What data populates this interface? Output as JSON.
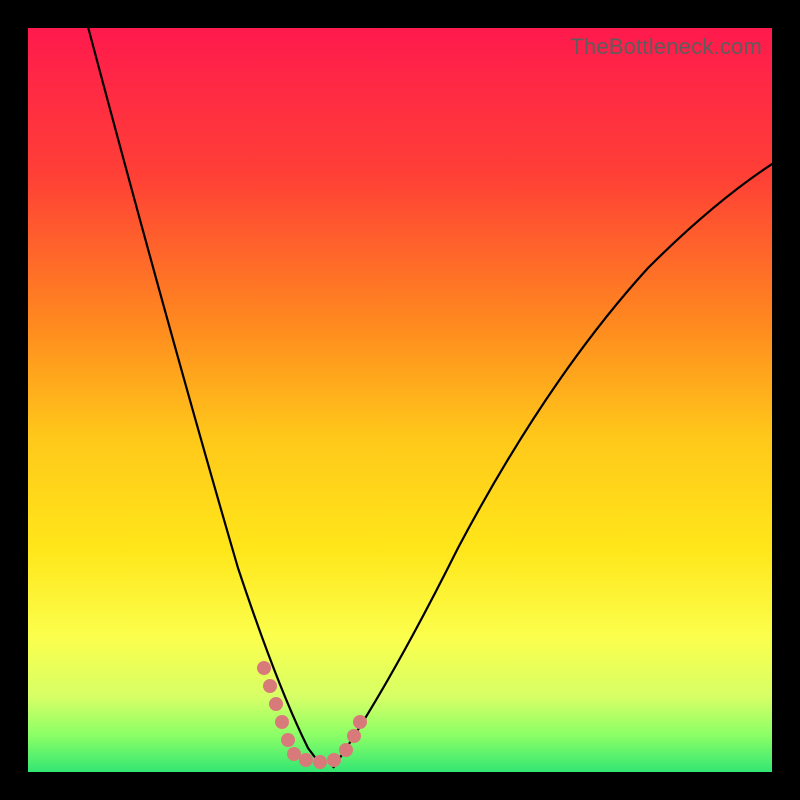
{
  "watermark": "TheBottleneck.com",
  "colors": {
    "black": "#000000",
    "curve_stroke": "#000000",
    "marker_fill": "#d97a7a",
    "gradient_stops": [
      {
        "offset": 0.0,
        "color": "#ff1a4d"
      },
      {
        "offset": 0.2,
        "color": "#ff4036"
      },
      {
        "offset": 0.4,
        "color": "#ff8a1f"
      },
      {
        "offset": 0.55,
        "color": "#ffc81a"
      },
      {
        "offset": 0.7,
        "color": "#ffe61a"
      },
      {
        "offset": 0.82,
        "color": "#fbff4d"
      },
      {
        "offset": 0.9,
        "color": "#d6ff66"
      },
      {
        "offset": 0.95,
        "color": "#8cff66"
      },
      {
        "offset": 1.0,
        "color": "#33e673"
      }
    ]
  },
  "chart_data": {
    "type": "line",
    "title": "",
    "xlabel": "",
    "ylabel": "",
    "xlim": [
      0,
      100
    ],
    "ylim": [
      0,
      100
    ],
    "x": [
      0,
      4,
      8,
      12,
      16,
      20,
      24,
      28,
      30,
      32,
      34,
      36,
      38,
      40,
      42,
      46,
      50,
      55,
      60,
      65,
      70,
      75,
      80,
      85,
      90,
      95,
      100
    ],
    "series": [
      {
        "name": "bottleneck-curve",
        "values": [
          125,
          108,
          92,
          77,
          63,
          50,
          38,
          27,
          22,
          17,
          12,
          7,
          3,
          0,
          3,
          11,
          20,
          29,
          38,
          46,
          53,
          59,
          65,
          70,
          75,
          79,
          83
        ]
      }
    ],
    "annotations": [
      {
        "type": "marker-segment",
        "x_range": [
          30,
          35
        ],
        "note": "left dotted V arm"
      },
      {
        "type": "marker-segment",
        "x_range": [
          36,
          44
        ],
        "note": "bottom dotted V arm"
      }
    ]
  }
}
